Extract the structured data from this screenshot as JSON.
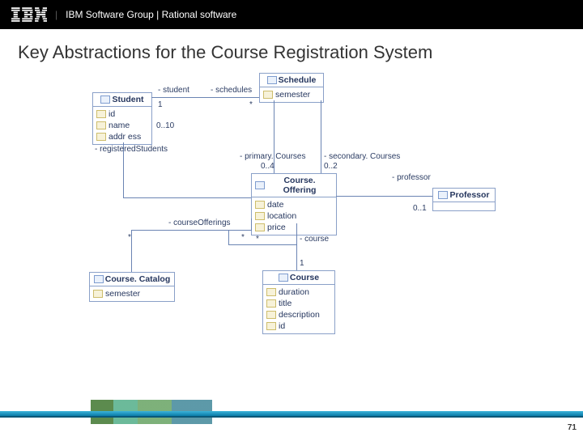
{
  "header": {
    "brand": "IBM",
    "breadcrumb": "IBM Software Group | Rational software"
  },
  "title": "Key Abstractions for the Course Registration System",
  "page_number": "71",
  "classes": {
    "schedule": {
      "name": "Schedule",
      "attrs": [
        "semester"
      ]
    },
    "student": {
      "name": "Student",
      "attrs": [
        "id",
        "name",
        "addr ess"
      ]
    },
    "courseOffering": {
      "name": "Course. Offering",
      "attrs": [
        "date",
        "location",
        "price"
      ]
    },
    "professor": {
      "name": "Professor"
    },
    "courseCatalog": {
      "name": "Course. Catalog",
      "attrs": [
        "semester"
      ]
    },
    "course": {
      "name": "Course",
      "attrs": [
        "duration",
        "title",
        "description",
        "id"
      ]
    }
  },
  "assoc": {
    "student_role": "- student",
    "student_mult": "1",
    "schedules_role": "- schedules",
    "schedules_mult": "*",
    "regStudents_role": "- registeredStudents",
    "regStudents_mult": "0..10",
    "primary_role": "- primary. Courses",
    "primary_mult": "0..4",
    "secondary_role": "- secondary. Courses",
    "secondary_mult": "0..2",
    "professor_role": "- professor",
    "professor_mult": "0..1",
    "offerings_role": "- courseOfferings",
    "offerings_mult": "*",
    "course_role": "- course",
    "course_mult": "1",
    "star": "*"
  }
}
